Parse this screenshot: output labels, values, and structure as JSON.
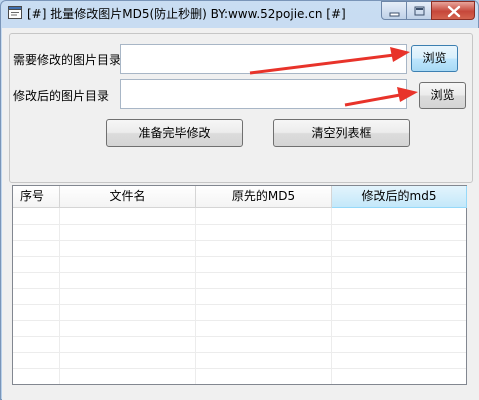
{
  "window": {
    "title": "[#] 批量修改图片MD5(防止秒删) BY:www.52pojie.cn [#]"
  },
  "form": {
    "source_dir_label": "需要修改的图片目录",
    "source_dir_value": "",
    "output_dir_label": "修改后的图片目录",
    "output_dir_value": "",
    "browse_label": "浏览",
    "prepare_button": "准备完毕修改",
    "clear_button": "清空列表框"
  },
  "listview": {
    "columns": [
      "序号",
      "文件名",
      "原先的MD5",
      "修改后的md5"
    ],
    "rows": []
  },
  "colors": {
    "arrow": "#e8332a",
    "header_active": "#c4e8fa"
  }
}
